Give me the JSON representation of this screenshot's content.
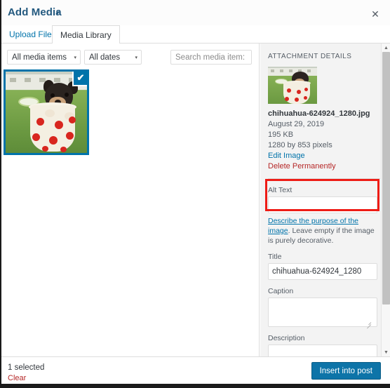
{
  "header": {
    "title": "Add Media",
    "caret": "▾",
    "close_icon": "✕"
  },
  "tabs": [
    {
      "label": "Upload Files",
      "active": false
    },
    {
      "label": "Media Library",
      "active": true
    }
  ],
  "toolbar": {
    "media_filter": "All media items",
    "date_filter": "All dates",
    "search_placeholder": "Search media item:",
    "search_value": "",
    "caret": "▾"
  },
  "grid": {
    "selected_check": "✔"
  },
  "sidebar": {
    "heading": "ATTACHMENT DETAILS",
    "file_name": "chihuahua-624924_1280.jpg",
    "date": "August 29, 2019",
    "file_size": "195 KB",
    "dimensions": "1280 by 853 pixels",
    "edit_image_link": "Edit Image",
    "delete_link": "Delete Permanently",
    "fields": {
      "alt_text_label": "Alt Text",
      "alt_text_value": "",
      "alt_help_link": "Describe the purpose of the image",
      "alt_help_text": ". Leave empty if the image is purely decorative.",
      "title_label": "Title",
      "title_value": "chihuahua-624924_1280",
      "caption_label": "Caption",
      "caption_value": "",
      "description_label": "Description",
      "description_value": ""
    }
  },
  "scrollbar": {
    "up_icon": "▲",
    "down_icon": "▼"
  },
  "footer": {
    "selected_count": "1 selected",
    "clear_label": "Clear",
    "insert_label": "Insert into post"
  },
  "colors": {
    "accent": "#0073aa",
    "title": "#23597f",
    "danger": "#b52727",
    "highlight": "#ee1c16",
    "button": "#0d74a8"
  }
}
